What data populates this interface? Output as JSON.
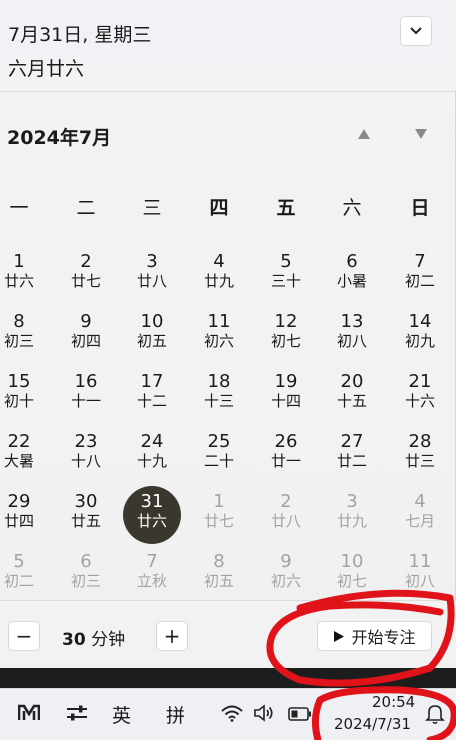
{
  "header": {
    "date_line": "7月31日, 星期三",
    "lunar_line": "六月廿六"
  },
  "calendar": {
    "month_title": "2024年7月",
    "weekdays": [
      "一",
      "二",
      "三",
      "四",
      "五",
      "六",
      "日"
    ],
    "rows": [
      [
        [
          "1",
          "廿六"
        ],
        [
          "2",
          "廿七"
        ],
        [
          "3",
          "廿八"
        ],
        [
          "4",
          "廿九"
        ],
        [
          "5",
          "三十"
        ],
        [
          "6",
          "小暑"
        ],
        [
          "7",
          "初二"
        ]
      ],
      [
        [
          "8",
          "初三"
        ],
        [
          "9",
          "初四"
        ],
        [
          "10",
          "初五"
        ],
        [
          "11",
          "初六"
        ],
        [
          "12",
          "初七"
        ],
        [
          "13",
          "初八"
        ],
        [
          "14",
          "初九"
        ]
      ],
      [
        [
          "15",
          "初十"
        ],
        [
          "16",
          "十一"
        ],
        [
          "17",
          "十二"
        ],
        [
          "18",
          "十三"
        ],
        [
          "19",
          "十四"
        ],
        [
          "20",
          "十五"
        ],
        [
          "21",
          "十六"
        ]
      ],
      [
        [
          "22",
          "大暑"
        ],
        [
          "23",
          "十八"
        ],
        [
          "24",
          "十九"
        ],
        [
          "25",
          "二十"
        ],
        [
          "26",
          "廿一"
        ],
        [
          "27",
          "廿二"
        ],
        [
          "28",
          "廿三"
        ]
      ],
      [
        [
          "29",
          "廿四"
        ],
        [
          "30",
          "廿五"
        ],
        [
          "31",
          "廿六"
        ],
        [
          "1",
          "廿七"
        ],
        [
          "2",
          "廿八"
        ],
        [
          "3",
          "廿九"
        ],
        [
          "4",
          "七月"
        ]
      ],
      [
        [
          "5",
          "初二"
        ],
        [
          "6",
          "初三"
        ],
        [
          "7",
          "立秋"
        ],
        [
          "8",
          "初五"
        ],
        [
          "9",
          "初六"
        ],
        [
          "10",
          "初七"
        ],
        [
          "11",
          "初八"
        ]
      ]
    ]
  },
  "focus": {
    "minus": "−",
    "duration_value": "30",
    "duration_unit": "分钟",
    "plus": "+",
    "start_label": "开始专注"
  },
  "taskbar": {
    "ime_lang": "英",
    "ime_mode": "拼",
    "time": "20:54",
    "date": "2024/7/31"
  },
  "colors": {
    "today_circle": "#3a372f",
    "annotation_red": "#e0131a"
  }
}
